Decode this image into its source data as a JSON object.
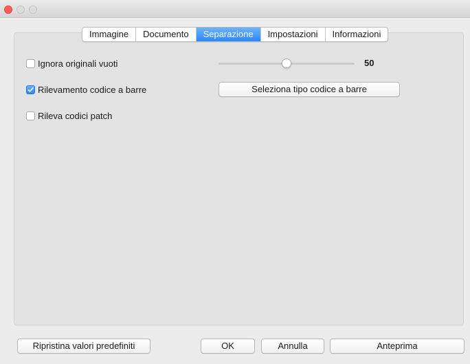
{
  "tabs": [
    {
      "label": "Immagine"
    },
    {
      "label": "Documento"
    },
    {
      "label": "Separazione"
    },
    {
      "label": "Impostazioni"
    },
    {
      "label": "Informazioni"
    }
  ],
  "active_tab": "Separazione",
  "options": {
    "ignore_blank": {
      "label": "Ignora originali vuoti",
      "checked": false
    },
    "barcode": {
      "label": "Rilevamento codice a barre",
      "checked": true
    },
    "patch": {
      "label": "Rileva codici patch",
      "checked": false
    }
  },
  "slider": {
    "value": "50",
    "fraction": 0.5
  },
  "barcode_type_button": "Seleziona tipo codice a barre",
  "footer": {
    "restore_label": "Ripristina valori predefiniti",
    "ok_label": "OK",
    "cancel_label": "Annulla",
    "preview_label": "Anteprima"
  },
  "colors": {
    "accent": "#2e86f6",
    "close_light": "#fc5f57",
    "pane_bg": "#e3e3e3",
    "window_bg": "#ececec"
  }
}
